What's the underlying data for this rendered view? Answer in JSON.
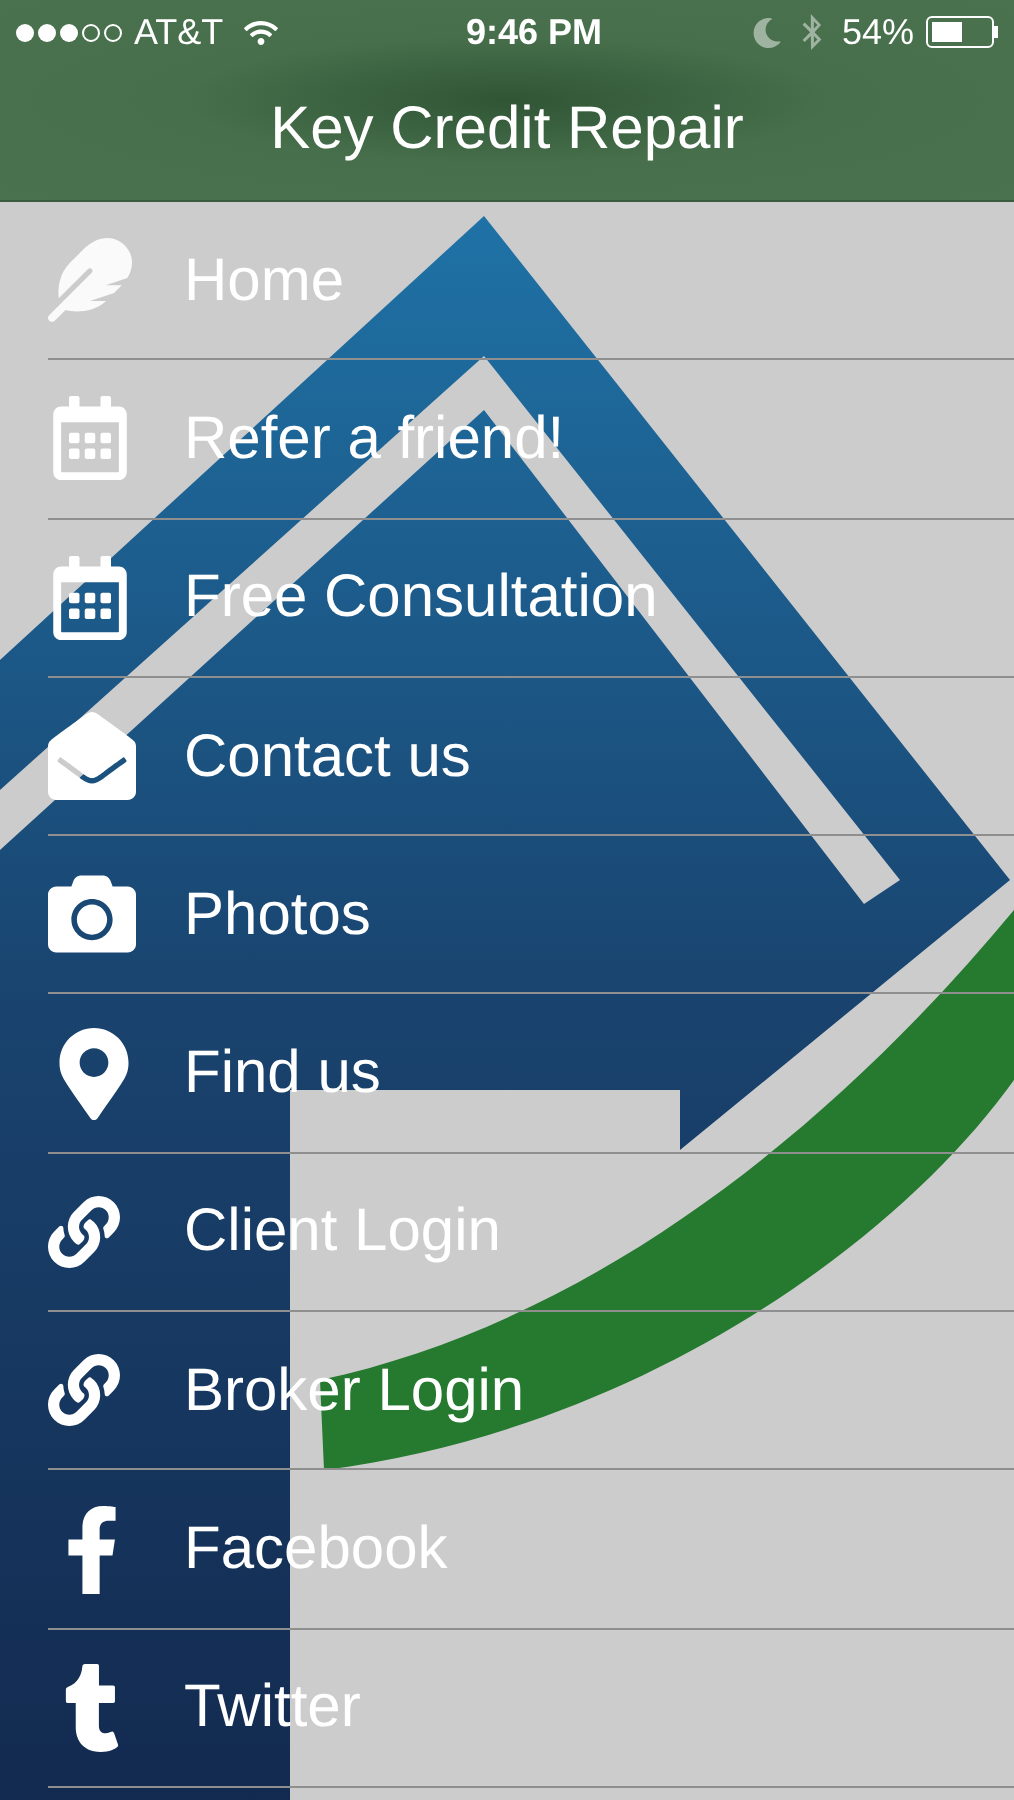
{
  "status_bar": {
    "signal_dots": [
      {
        "filled": true
      },
      {
        "filled": true
      },
      {
        "filled": true
      },
      {
        "filled": false
      },
      {
        "filled": false
      }
    ],
    "carrier": "AT&T",
    "time": "9:46 PM",
    "battery": "54%"
  },
  "nav_bar": {
    "title": "Key Credit Repair"
  },
  "menu": [
    {
      "kind": "feather",
      "label": "Home"
    },
    {
      "kind": "calendar",
      "label": "Refer a friend!"
    },
    {
      "kind": "calendar",
      "label": "Free Consultation"
    },
    {
      "kind": "envelope",
      "label": "Contact us"
    },
    {
      "kind": "camera",
      "label": "Photos"
    },
    {
      "kind": "pin",
      "label": "Find us"
    },
    {
      "kind": "chain",
      "label": "Client Login"
    },
    {
      "kind": "chain",
      "label": "Broker Login"
    },
    {
      "kind": "facebook",
      "label": "Facebook"
    },
    {
      "kind": "tletter",
      "label": "Twitter"
    }
  ]
}
